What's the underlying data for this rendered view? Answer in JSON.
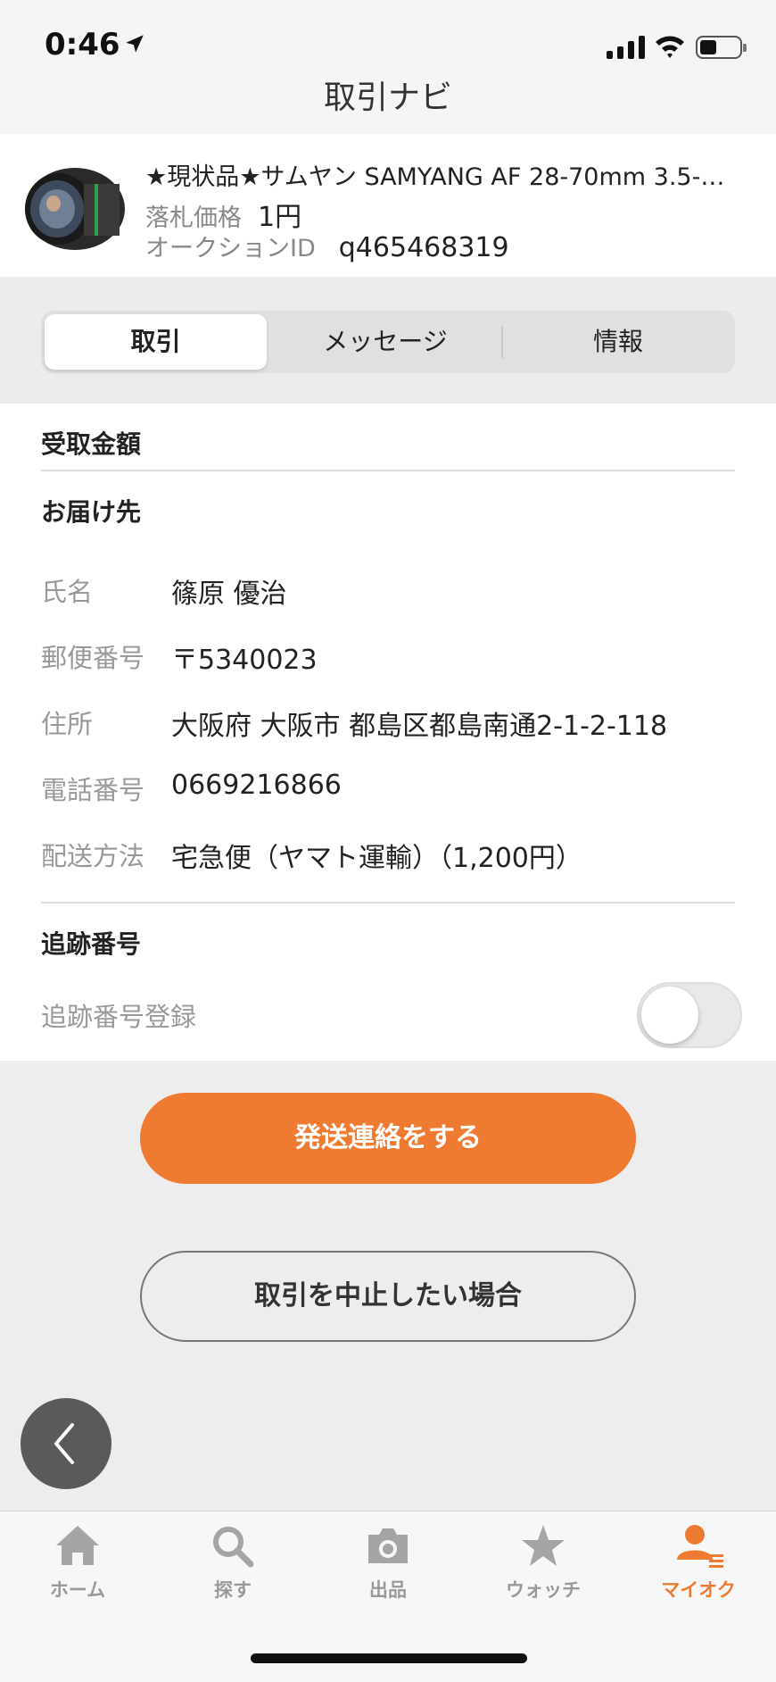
{
  "status_bar": {
    "time": "0:46"
  },
  "nav": {
    "title": "取引ナビ"
  },
  "item": {
    "title": "★現状品★サムヤン SAMYANG AF 28-70mm 3.5-…",
    "price_label": "落札価格",
    "price_value": "1円",
    "auction_id_label": "オークションID",
    "auction_id_value": "q465468319"
  },
  "segments": [
    {
      "label": "取引",
      "active": true
    },
    {
      "label": "メッセージ",
      "active": false
    },
    {
      "label": "情報",
      "active": false
    }
  ],
  "sections": {
    "received_amount": {
      "heading": "受取金額"
    },
    "delivery": {
      "heading": "お届け先",
      "rows": [
        {
          "label": "氏名",
          "value": "篠原 優治"
        },
        {
          "label": "郵便番号",
          "value": "〒5340023"
        },
        {
          "label": "住所",
          "value": "大阪府 大阪市 都島区都島南通2-1-2-118"
        },
        {
          "label": "電話番号",
          "value": "0669216866"
        },
        {
          "label": "配送方法",
          "value": "宅急便（ヤマト運輸）（1,200円）"
        }
      ]
    },
    "tracking": {
      "heading": "追跡番号",
      "register_label": "追跡番号登録",
      "toggle_on": false
    }
  },
  "actions": {
    "primary": "発送連絡をする",
    "secondary": "取引を中止したい場合"
  },
  "tabbar": {
    "items": [
      {
        "label": "ホーム",
        "icon": "home-icon",
        "active": false
      },
      {
        "label": "探す",
        "icon": "search-icon",
        "active": false
      },
      {
        "label": "出品",
        "icon": "camera-icon",
        "active": false
      },
      {
        "label": "ウォッチ",
        "icon": "star-icon",
        "active": false
      },
      {
        "label": "マイオク",
        "icon": "my-auction-icon",
        "active": true
      }
    ]
  },
  "colors": {
    "accent": "#ef7a31",
    "inactive_tab": "#999999"
  }
}
